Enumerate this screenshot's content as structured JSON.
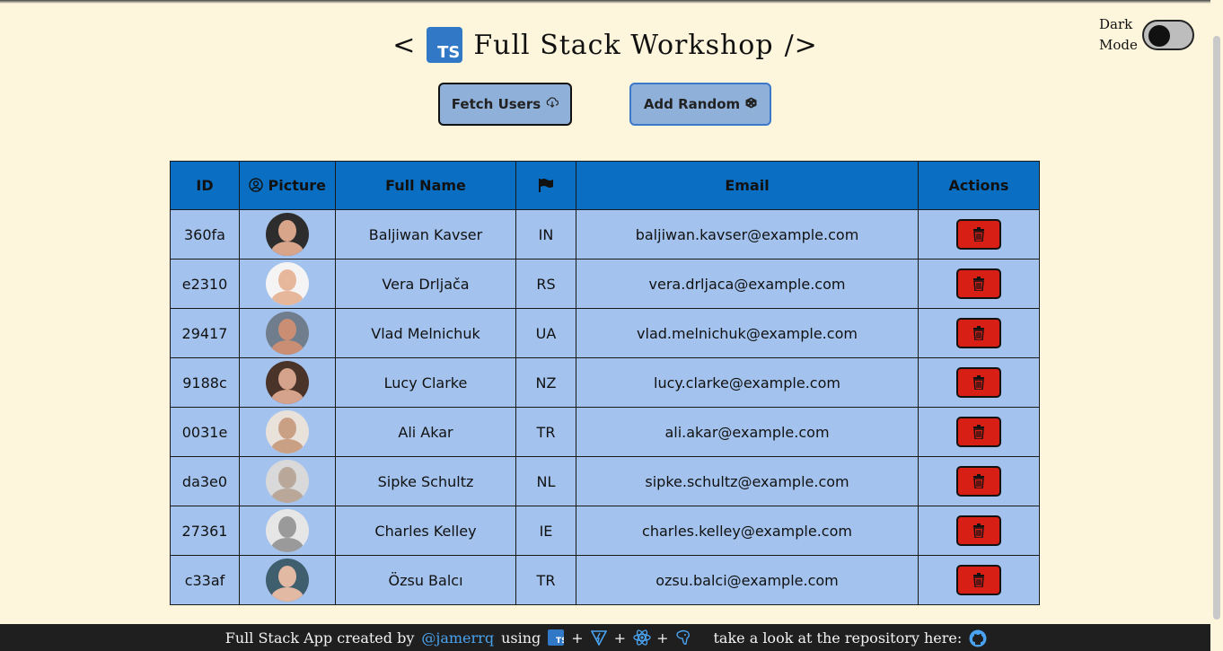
{
  "header": {
    "open_bracket": "<",
    "logo_text": "TS",
    "title": "Full Stack Workshop",
    "close_bracket": "/>"
  },
  "dark_mode": {
    "label_line1": "Dark",
    "label_line2": "Mode",
    "enabled": false
  },
  "toolbar": {
    "fetch_label": "Fetch Users",
    "fetch_icon": "cloud-download-icon",
    "random_label": "Add Random",
    "random_icon": "dice-icon"
  },
  "table": {
    "headers": {
      "id": "ID",
      "picture": "Picture",
      "picture_icon": "user-circle-icon",
      "name": "Full Name",
      "flag_icon": "flag-icon",
      "email": "Email",
      "actions": "Actions"
    },
    "rows": [
      {
        "id": "360fa",
        "name": "Baljiwan Kavser",
        "nat": "IN",
        "email": "baljiwan.kavser@example.com",
        "avatar_bg": "#2d2d2d",
        "avatar_skin": "#d8a58a"
      },
      {
        "id": "e2310",
        "name": "Vera Drljača",
        "nat": "RS",
        "email": "vera.drljaca@example.com",
        "avatar_bg": "#f4f4f4",
        "avatar_skin": "#e7b79c"
      },
      {
        "id": "29417",
        "name": "Vlad Melnichuk",
        "nat": "UA",
        "email": "vlad.melnichuk@example.com",
        "avatar_bg": "#6f7d8c",
        "avatar_skin": "#c98e74"
      },
      {
        "id": "9188c",
        "name": "Lucy Clarke",
        "nat": "NZ",
        "email": "lucy.clarke@example.com",
        "avatar_bg": "#4a3328",
        "avatar_skin": "#d5a38b"
      },
      {
        "id": "0031e",
        "name": "Ali Akar",
        "nat": "TR",
        "email": "ali.akar@example.com",
        "avatar_bg": "#e9e2da",
        "avatar_skin": "#caa085"
      },
      {
        "id": "da3e0",
        "name": "Sipke Schultz",
        "nat": "NL",
        "email": "sipke.schultz@example.com",
        "avatar_bg": "#d9d9d9",
        "avatar_skin": "#b9a79a"
      },
      {
        "id": "27361",
        "name": "Charles Kelley",
        "nat": "IE",
        "email": "charles.kelley@example.com",
        "avatar_bg": "#e6e6e6",
        "avatar_skin": "#9a9a9a"
      },
      {
        "id": "c33af",
        "name": "Özsu Balcı",
        "nat": "TR",
        "email": "ozsu.balci@example.com",
        "avatar_bg": "#3f5e6e",
        "avatar_skin": "#e2b9a3"
      }
    ],
    "delete_icon": "trash-icon"
  },
  "footer": {
    "created_text": "Full Stack App created by",
    "author_link": "@jamerrq",
    "using_text": "using",
    "plus": "+",
    "repo_text": "take a look at the repository here:",
    "tech_icons": [
      "typescript-icon",
      "vite-icon",
      "react-icon",
      "postgresql-icon"
    ],
    "repo_icon": "github-icon"
  },
  "colors": {
    "background": "#fef6dc",
    "table_header": "#0a6fc2",
    "table_row": "#a3c3ee",
    "button": "#8fb0d8",
    "delete": "#d71f16",
    "footer": "#1f1f1f",
    "link": "#4aa3f0"
  }
}
